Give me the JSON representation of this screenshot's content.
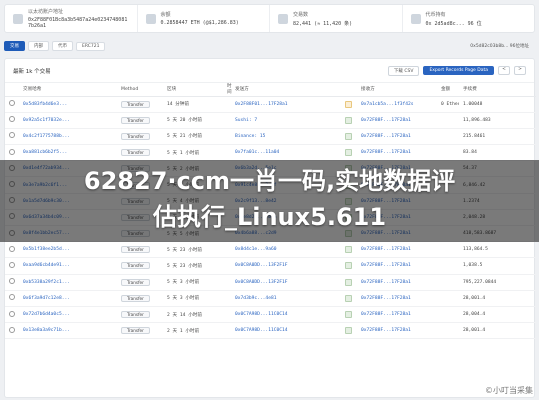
{
  "summary": [
    {
      "label": "以太坊账户地址",
      "value": "0x2F88F01Bc8a3b5487a24e0234748081 7b26a1"
    },
    {
      "label": "余额",
      "value": "0.2858447 ETH (@$1,286.83)"
    },
    {
      "label": "交易数",
      "value": "82,441 (≈ 11,420 条)"
    },
    {
      "label": "代币持有",
      "value": "0x 2d5ad8c... 96 位"
    }
  ],
  "tabs": [
    "交易",
    "内部",
    "代币",
    "ERC721"
  ],
  "tabs_right": "0x5d82c03b8b... 96位地址",
  "table_title": "最新 1k 个交易",
  "buttons": {
    "download": "下载 CSV",
    "filter": "Export Records Page Data",
    "first": "<",
    "last": ">"
  },
  "columns": [
    "",
    "交易哈希",
    "Method",
    "区块",
    "时间",
    "发送方",
    "",
    "接收方",
    "金额",
    "手续费"
  ],
  "rows": [
    {
      "hash": "0x5d83fb4d6e3...",
      "method": "Transfer",
      "block": "14 分钟前",
      "time": "",
      "from": "0x2F88F01...17F28a1",
      "dir": "OUT",
      "to": "0x7a1cb5a...1f3f42s",
      "value": "0 Ether",
      "fee": "1.00048"
    },
    {
      "hash": "0x92a5c1f7032e...",
      "method": "Transfer",
      "block": "5 天 20 小时前",
      "time": "",
      "from": "Sushi: 7",
      "dir": "IN",
      "to": "0x72F88F...17F28a1",
      "value": "",
      "fee": "11,896.483"
    },
    {
      "hash": "0x4c2f1775788b...",
      "method": "Transfer",
      "block": "5 天 21 小时前",
      "time": "",
      "from": "Binance: 15",
      "dir": "IN",
      "to": "0x72F88F...17F28a1",
      "value": "",
      "fee": "215.8461"
    },
    {
      "hash": "0xa881cb6b2f5...",
      "method": "Transfer",
      "block": "5 天 1 小时前",
      "time": "",
      "from": "0x7fa01c...11a04",
      "dir": "IN",
      "to": "0x72F88F...17F28a1",
      "value": "",
      "fee": "83.84"
    },
    {
      "hash": "0xd1e4f72ab934...",
      "method": "Transfer",
      "block": "5 天 2 小时前",
      "time": "",
      "from": "0x6b3a2d...5e1c",
      "dir": "IN",
      "to": "0x72F88F...17F28a1",
      "value": "",
      "fee": "54.37"
    },
    {
      "hash": "0x3e7a9b2c6f1...",
      "method": "Transfer",
      "block": "5 天 3 小时前",
      "time": "",
      "from": "0x91c4e8...3a7f",
      "dir": "IN",
      "to": "0x72F88F...17F28a1",
      "value": "",
      "fee": "6,846.42"
    },
    {
      "hash": "0x1a5d7d6b9c30...",
      "method": "Transfer",
      "block": "5 天 4 小时前",
      "time": "",
      "from": "0x2c9f13...8e42",
      "dir": "IN",
      "to": "0x72F88F...17F28a1",
      "value": "",
      "fee": "1.2374"
    },
    {
      "hash": "0x6d37a34b4c09...",
      "method": "Transfer",
      "block": "5 天 5 小时前",
      "time": "",
      "from": "0x5e8d21...7b1a",
      "dir": "IN",
      "to": "0x72F88F...17F28a1",
      "value": "",
      "fee": "2,048.28"
    },
    {
      "hash": "0x8f4e1bb2ec57...",
      "method": "Transfer",
      "block": "5 天 5 小时前",
      "time": "",
      "from": "0x4b6a88...c2d9",
      "dir": "IN",
      "to": "0x72F88F...17F28a1",
      "value": "",
      "fee": "418,583.8687"
    },
    {
      "hash": "0x5b1f38ee2b5d...",
      "method": "Transfer",
      "block": "5 天 23 小时前",
      "time": "",
      "from": "0x8d4c1e...9a60",
      "dir": "IN",
      "to": "0x72F88F...17F28a1",
      "value": "",
      "fee": "113,864.5"
    },
    {
      "hash": "0xaa9d6cb4de91...",
      "method": "Transfer",
      "block": "5 天 23 小时前",
      "time": "",
      "from": "0x0C8A0DD...13F2F1F",
      "dir": "IN",
      "to": "0x72F88F...17F28a1",
      "value": "",
      "fee": "1,038.5"
    },
    {
      "hash": "0xb5338a29f2c1...",
      "method": "Transfer",
      "block": "5 天 3 小时前",
      "time": "",
      "from": "0x0C8A0DD...13F2F1F",
      "dir": "IN",
      "to": "0x72F88F...17F28a1",
      "value": "",
      "fee": "795,227.0844"
    },
    {
      "hash": "0x6f3a9d7c12e8...",
      "method": "Transfer",
      "block": "5 天 3 小时前",
      "time": "",
      "from": "0x7d3b9c...4e81",
      "dir": "IN",
      "to": "0x72F88F...17F28a1",
      "value": "",
      "fee": "28,001.4"
    },
    {
      "hash": "0x72d7b6d4a0c5...",
      "method": "Transfer",
      "block": "2 天 14 小时前",
      "time": "",
      "from": "0x0C7A98D...11C0C14",
      "dir": "IN",
      "to": "0x72F88F...17F28a1",
      "value": "",
      "fee": "28,004.4"
    },
    {
      "hash": "0x13e8a3a9c71b...",
      "method": "Transfer",
      "block": "2 天 1 小时前",
      "time": "",
      "from": "0x0C7A98D...11C0C14",
      "dir": "IN",
      "to": "0x72F88F...17F28a1",
      "value": "",
      "fee": "28,001.4"
    }
  ],
  "overlay": {
    "line1": "62827·ccm一肖一码,实地数据评",
    "line2": "估执行_Linux5.611"
  },
  "corner": "©小叮当采集"
}
